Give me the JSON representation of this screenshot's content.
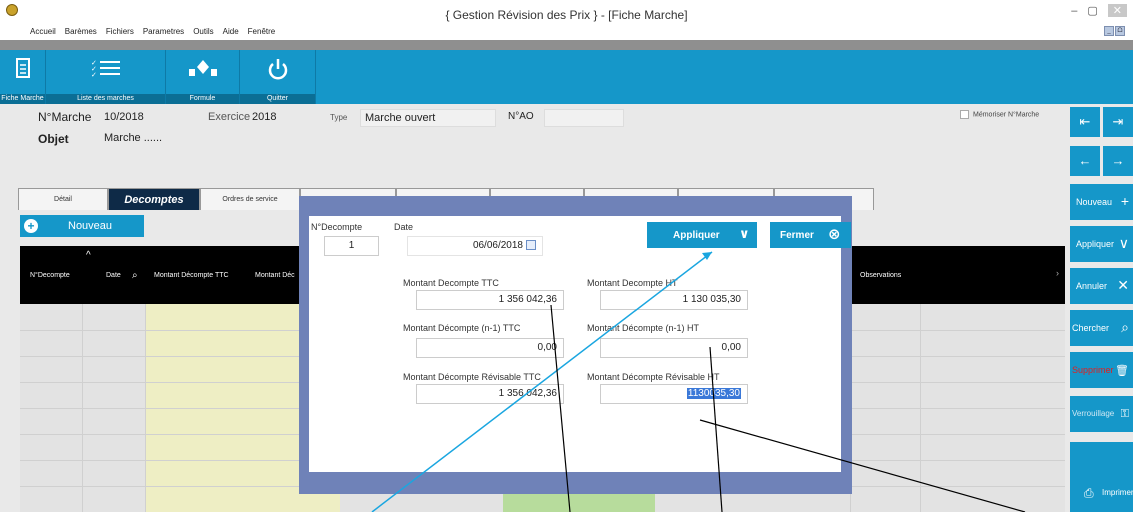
{
  "window": {
    "title": "{  Gestion Révision des Prix  } - [Fiche Marche]",
    "min": "–",
    "max": "▢",
    "close": "✕"
  },
  "menu": [
    "Accueil",
    "Barèmes",
    "Fichiers",
    "Parametres",
    "Outils",
    "Aide",
    "Fenêtre"
  ],
  "mdi": [
    "_",
    "ᗝ"
  ],
  "ribbon": [
    {
      "icon": "document-icon",
      "label": "Fiche Marche"
    },
    {
      "icon": "list-icon",
      "label": "Liste des marches"
    },
    {
      "icon": "formula-icon",
      "label": "Formule"
    },
    {
      "icon": "power-icon",
      "label": "Quitter"
    }
  ],
  "header": {
    "marche_label": "N°Marche",
    "marche_value": "10/2018",
    "exercice_label": "Exercice",
    "exercice_value": "2018",
    "type_label": "Type",
    "type_value": "Marche ouvert",
    "ao_label": "N°AO",
    "ao_value": "",
    "objet_label": "Objet",
    "objet_value": "Marche ......",
    "memo_label": "Mémoriser N°Marche"
  },
  "tabs": [
    "Détail",
    "Decomptes",
    "Ordres de service",
    "",
    "",
    "",
    "",
    "",
    ""
  ],
  "nouveau_label": "Nouveau",
  "grid": {
    "headers": [
      "N°Decompte",
      "Date",
      "Montant Décompte TTC",
      "Montant Déc",
      "Observations"
    ]
  },
  "side": {
    "nav": [
      "⇤",
      "⇥",
      "←",
      "→"
    ],
    "buttons": [
      {
        "label": "Nouveau",
        "icon": "+"
      },
      {
        "label": "Appliquer",
        "icon": "∨"
      },
      {
        "label": "Annuler",
        "icon": "✕"
      },
      {
        "label": "Chercher",
        "icon": "⌕"
      },
      {
        "label": "Supprimer",
        "icon": "🗑"
      },
      {
        "label": "Verrouillage",
        "icon": "⚿"
      },
      {
        "label": "Imprimer",
        "icon": "⎙"
      }
    ]
  },
  "dialog": {
    "decompte_label": "N°Decompte",
    "decompte_value": "1",
    "date_label": "Date",
    "date_value": "06/06/2018",
    "appliquer_label": "Appliquer",
    "appliquer_icon": "∨",
    "fermer_label": "Fermer",
    "fermer_icon": "⊗",
    "ttc_label": "Montant Decompte TTC",
    "ttc_value": "1 356 042,36",
    "ht_label": "Montant Decompte HT",
    "ht_value": "1 130 035,30",
    "prev_ttc_label": "Montant Décompte (n-1) TTC",
    "prev_ttc_value": "0,00",
    "prev_ht_label": "Montant Décompte (n-1) HT",
    "prev_ht_value": "0,00",
    "rev_ttc_label": "Montant Décompte Révisable TTC",
    "rev_ttc_value": "1 356 042,36",
    "rev_ht_label": "Montant Décompte Révisable HT",
    "rev_ht_value": "1130035,30"
  }
}
